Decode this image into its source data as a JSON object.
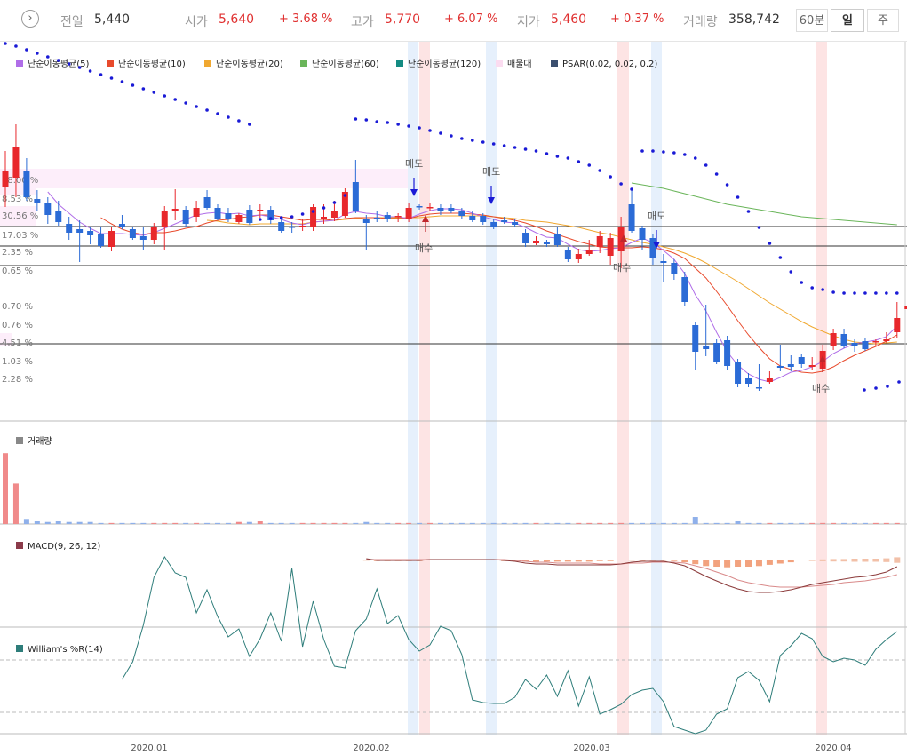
{
  "header": {
    "prev_label": "전일",
    "prev_value": "5,440",
    "open_label": "시가",
    "open_value": "5,640",
    "open_pct": "+ 3.68 %",
    "high_label": "고가",
    "high_value": "5,770",
    "high_pct": "+ 6.07 %",
    "low_label": "저가",
    "low_value": "5,460",
    "low_pct": "+ 0.37 %",
    "volume_label": "거래량",
    "volume_value": "358,742",
    "periods": [
      "60분",
      "일",
      "주"
    ],
    "active_period": "일"
  },
  "legend": [
    {
      "label": "단순이동평균(5)",
      "color": "#b06ee8"
    },
    {
      "label": "단순이동평균(10)",
      "color": "#e84a2c"
    },
    {
      "label": "단순이동평균(20)",
      "color": "#f0a830"
    },
    {
      "label": "단순이동평균(60)",
      "color": "#6ab55a"
    },
    {
      "label": "단순이동평균(120)",
      "color": "#138b82"
    },
    {
      "label": "매물대",
      "color": "#fbdcf0"
    },
    {
      "label": "PSAR(0.02, 0.02, 0.2)",
      "color": "#3a4e6e"
    }
  ],
  "colors": {
    "up": "#e8282c",
    "down": "#2b6bd6",
    "psar": "#1a1ad6",
    "macd": "#8b3a3a",
    "signal": "#d98a8a",
    "williams": "#2e7d7a"
  },
  "chart_data": {
    "type": "candlestick",
    "price_axis_labels": [
      "48.00 %",
      "8.53 %",
      "30.56 %",
      "17.03 %",
      "2.35 %",
      "0.65 %",
      "0.70 %",
      "0.76 %",
      "4.51 %",
      "1.03 %",
      "2.28 %"
    ],
    "x_tick_labels": [
      "2020.01",
      "2020.02",
      "2020.03",
      "2020.04"
    ],
    "signal_labels": [
      "매도",
      "매수",
      "매도",
      "매수",
      "매도",
      "매수"
    ],
    "volume_panel_title": "거래량",
    "macd_panel_title": "MACD(9, 26, 12)",
    "williams_panel_title": "William's %R(14)",
    "candles": [
      {
        "o": 210,
        "c": 193,
        "h": 170,
        "l": 233
      },
      {
        "o": 200,
        "c": 165,
        "h": 140,
        "l": 222
      },
      {
        "o": 192,
        "c": 222,
        "h": 178,
        "l": 226
      },
      {
        "o": 224,
        "c": 228,
        "h": 214,
        "l": 238
      },
      {
        "o": 228,
        "c": 242,
        "h": 222,
        "l": 252
      },
      {
        "o": 238,
        "c": 250,
        "h": 226,
        "l": 254
      },
      {
        "o": 252,
        "c": 262,
        "h": 244,
        "l": 270
      },
      {
        "o": 258,
        "c": 262,
        "h": 248,
        "l": 295
      },
      {
        "o": 260,
        "c": 265,
        "h": 255,
        "l": 275
      },
      {
        "o": 263,
        "c": 277,
        "h": 256,
        "l": 279
      },
      {
        "o": 278,
        "c": 260,
        "h": 256,
        "l": 283
      },
      {
        "o": 252,
        "c": 255,
        "h": 242,
        "l": 258
      },
      {
        "o": 258,
        "c": 268,
        "h": 255,
        "l": 270
      },
      {
        "o": 266,
        "c": 270,
        "h": 255,
        "l": 282
      },
      {
        "o": 270,
        "c": 255,
        "h": 251,
        "l": 275
      },
      {
        "o": 255,
        "c": 238,
        "h": 232,
        "l": 282
      },
      {
        "o": 238,
        "c": 235,
        "h": 213,
        "l": 248
      },
      {
        "o": 236,
        "c": 252,
        "h": 232,
        "l": 255
      },
      {
        "o": 244,
        "c": 234,
        "h": 226,
        "l": 250
      },
      {
        "o": 222,
        "c": 234,
        "h": 214,
        "l": 236
      },
      {
        "o": 234,
        "c": 246,
        "h": 230,
        "l": 248
      },
      {
        "o": 240,
        "c": 247,
        "h": 234,
        "l": 250
      },
      {
        "o": 250,
        "c": 242,
        "h": 240,
        "l": 252
      },
      {
        "o": 236,
        "c": 251,
        "h": 231,
        "l": 253
      },
      {
        "o": 238,
        "c": 236,
        "h": 230,
        "l": 245
      },
      {
        "o": 236,
        "c": 248,
        "h": 232,
        "l": 252
      },
      {
        "o": 250,
        "c": 260,
        "h": 246,
        "l": 262
      },
      {
        "o": 255,
        "c": 255,
        "h": 250,
        "l": 262
      },
      {
        "o": 256,
        "c": 254,
        "h": 246,
        "l": 260
      },
      {
        "o": 256,
        "c": 233,
        "h": 230,
        "l": 260
      },
      {
        "o": 247,
        "c": 244,
        "h": 230,
        "l": 252
      },
      {
        "o": 245,
        "c": 237,
        "h": 226,
        "l": 249
      },
      {
        "o": 243,
        "c": 216,
        "h": 212,
        "l": 245
      },
      {
        "o": 205,
        "c": 237,
        "h": 180,
        "l": 240
      },
      {
        "o": 246,
        "c": 251,
        "h": 242,
        "l": 282
      },
      {
        "o": 245,
        "c": 245,
        "h": 238,
        "l": 250
      },
      {
        "o": 242,
        "c": 247,
        "h": 239,
        "l": 250
      },
      {
        "o": 244,
        "c": 243,
        "h": 240,
        "l": 250
      },
      {
        "o": 246,
        "c": 234,
        "h": 228,
        "l": 250
      },
      {
        "o": 232,
        "c": 233,
        "h": 230,
        "l": 236
      },
      {
        "o": 234,
        "c": 233,
        "h": 228,
        "l": 238
      },
      {
        "o": 234,
        "c": 238,
        "h": 230,
        "l": 242
      },
      {
        "o": 234,
        "c": 238,
        "h": 230,
        "l": 240
      },
      {
        "o": 238,
        "c": 243,
        "h": 234,
        "l": 246
      },
      {
        "o": 243,
        "c": 248,
        "h": 238,
        "l": 250
      },
      {
        "o": 243,
        "c": 250,
        "h": 240,
        "l": 253
      },
      {
        "o": 250,
        "c": 256,
        "h": 246,
        "l": 258
      },
      {
        "o": 248,
        "c": 250,
        "h": 244,
        "l": 252
      },
      {
        "o": 250,
        "c": 253,
        "h": 246,
        "l": 255
      },
      {
        "o": 262,
        "c": 274,
        "h": 258,
        "l": 278
      },
      {
        "o": 274,
        "c": 271,
        "h": 266,
        "l": 276
      },
      {
        "o": 272,
        "c": 275,
        "h": 270,
        "l": 278
      },
      {
        "o": 264,
        "c": 276,
        "h": 255,
        "l": 278
      },
      {
        "o": 282,
        "c": 292,
        "h": 278,
        "l": 295
      },
      {
        "o": 292,
        "c": 286,
        "h": 280,
        "l": 296
      },
      {
        "o": 286,
        "c": 282,
        "h": 270,
        "l": 288
      },
      {
        "o": 278,
        "c": 266,
        "h": 260,
        "l": 285
      },
      {
        "o": 288,
        "c": 268,
        "h": 262,
        "l": 298
      },
      {
        "o": 283,
        "c": 256,
        "h": 244,
        "l": 302
      },
      {
        "o": 230,
        "c": 260,
        "h": 214,
        "l": 262
      },
      {
        "o": 257,
        "c": 270,
        "h": 254,
        "l": 282
      },
      {
        "o": 268,
        "c": 290,
        "h": 264,
        "l": 298
      },
      {
        "o": 294,
        "c": 296,
        "h": 286,
        "l": 318
      },
      {
        "o": 296,
        "c": 308,
        "h": 292,
        "l": 315
      },
      {
        "o": 312,
        "c": 340,
        "h": 306,
        "l": 345
      },
      {
        "o": 366,
        "c": 396,
        "h": 362,
        "l": 416
      },
      {
        "o": 390,
        "c": 393,
        "h": 343,
        "l": 401
      },
      {
        "o": 386,
        "c": 407,
        "h": 382,
        "l": 410
      },
      {
        "o": 383,
        "c": 412,
        "h": 378,
        "l": 416
      },
      {
        "o": 408,
        "c": 432,
        "h": 404,
        "l": 436
      },
      {
        "o": 426,
        "c": 432,
        "h": 420,
        "l": 436
      },
      {
        "o": 436,
        "c": 436,
        "h": 410,
        "l": 440
      },
      {
        "o": 430,
        "c": 426,
        "h": 418,
        "l": 432
      },
      {
        "o": 412,
        "c": 414,
        "h": 388,
        "l": 418
      },
      {
        "o": 410,
        "c": 413,
        "h": 400,
        "l": 418
      },
      {
        "o": 402,
        "c": 410,
        "h": 398,
        "l": 414
      },
      {
        "o": 413,
        "c": 411,
        "h": 402,
        "l": 416
      },
      {
        "o": 415,
        "c": 395,
        "h": 388,
        "l": 416
      },
      {
        "o": 390,
        "c": 375,
        "h": 370,
        "l": 394
      },
      {
        "o": 376,
        "c": 389,
        "h": 370,
        "l": 392
      },
      {
        "o": 386,
        "c": 390,
        "h": 382,
        "l": 396
      },
      {
        "o": 384,
        "c": 393,
        "h": 380,
        "l": 395
      },
      {
        "o": 385,
        "c": 384,
        "h": 382,
        "l": 390
      },
      {
        "o": 384,
        "c": 382,
        "h": 374,
        "l": 386
      },
      {
        "o": 374,
        "c": 358,
        "h": 340,
        "l": 380
      },
      {
        "o": 348,
        "c": 344,
        "h": 340,
        "l": 358
      }
    ],
    "ma5": [
      null,
      null,
      null,
      null,
      216,
      230,
      240,
      250,
      257,
      263,
      263,
      263,
      264,
      265,
      262,
      257,
      252,
      247,
      242,
      240,
      239,
      241,
      240,
      243,
      242,
      244,
      247,
      251,
      253,
      250,
      249,
      248,
      241,
      238,
      240,
      241,
      244,
      244,
      246,
      241,
      237,
      235,
      235,
      236,
      240,
      244,
      247,
      250,
      251,
      256,
      262,
      267,
      268,
      275,
      281,
      283,
      282,
      280,
      279,
      273,
      268,
      273,
      282,
      292,
      308,
      332,
      350,
      374,
      396,
      411,
      421,
      427,
      430,
      425,
      419,
      417,
      413,
      407,
      398,
      392,
      387,
      385,
      383,
      379,
      367
    ],
    "ma10": [
      null,
      null,
      null,
      null,
      null,
      null,
      null,
      null,
      null,
      245,
      252,
      258,
      262,
      264,
      262,
      262,
      260,
      257,
      255,
      251,
      248,
      247,
      245,
      244,
      242,
      242,
      244,
      246,
      248,
      247,
      247,
      248,
      246,
      245,
      245,
      245,
      246,
      246,
      246,
      243,
      241,
      240,
      240,
      240,
      241,
      242,
      244,
      246,
      248,
      251,
      255,
      260,
      264,
      268,
      272,
      275,
      278,
      279,
      279,
      279,
      278,
      279,
      281,
      285,
      291,
      302,
      313,
      328,
      344,
      361,
      377,
      391,
      404,
      412,
      416,
      419,
      420,
      418,
      413,
      406,
      400,
      395,
      390,
      384,
      377
    ],
    "ma20": [
      null,
      null,
      null,
      null,
      null,
      null,
      null,
      null,
      null,
      null,
      null,
      null,
      null,
      null,
      null,
      null,
      null,
      null,
      null,
      248,
      249,
      251,
      252,
      253,
      252,
      252,
      252,
      252,
      252,
      250,
      249,
      248,
      247,
      246,
      245,
      245,
      245,
      245,
      245,
      245,
      244,
      243,
      243,
      243,
      243,
      243,
      244,
      245,
      246,
      248,
      249,
      250,
      252,
      254,
      256,
      259,
      262,
      264,
      267,
      270,
      273,
      275,
      278,
      281,
      285,
      290,
      296,
      303,
      310,
      317,
      325,
      333,
      341,
      348,
      355,
      362,
      368,
      373,
      378,
      382,
      385,
      386,
      387,
      386,
      385
    ],
    "ma60": [
      null,
      null,
      null,
      null,
      null,
      null,
      null,
      null,
      null,
      null,
      null,
      null,
      null,
      null,
      null,
      null,
      null,
      null,
      null,
      null,
      null,
      null,
      null,
      null,
      null,
      null,
      null,
      null,
      null,
      null,
      null,
      null,
      null,
      null,
      null,
      null,
      null,
      null,
      null,
      null,
      null,
      null,
      null,
      null,
      null,
      null,
      null,
      null,
      null,
      null,
      null,
      null,
      null,
      null,
      null,
      null,
      null,
      null,
      null,
      206,
      208,
      210,
      212,
      215,
      218,
      221,
      224,
      227,
      230,
      232,
      234,
      236,
      238,
      240,
      242,
      244,
      245,
      246,
      247,
      248,
      249,
      250,
      251,
      252,
      253
    ],
    "psar": [
      49,
      52,
      56,
      60,
      64,
      68,
      72,
      76,
      80,
      84,
      88,
      92,
      96,
      100,
      104,
      108,
      112,
      116,
      120,
      124,
      128,
      132,
      136,
      140,
      247,
      246,
      245,
      244,
      241,
      238,
      234,
      228,
      220,
      134,
      135,
      137,
      138,
      140,
      142,
      144,
      147,
      150,
      153,
      156,
      158,
      160,
      162,
      164,
      166,
      168,
      170,
      173,
      176,
      178,
      182,
      186,
      192,
      199,
      207,
      213,
      170,
      170,
      171,
      172,
      174,
      178,
      186,
      196,
      208,
      222,
      238,
      256,
      274,
      290,
      306,
      318,
      324,
      326,
      329,
      330,
      330,
      330,
      330,
      330,
      330
    ],
    "volume": [
      140,
      80,
      10,
      6,
      4,
      6,
      4,
      4,
      4,
      2,
      2,
      2,
      2,
      2,
      2,
      2,
      2,
      2,
      2,
      2,
      2,
      2,
      4,
      4,
      6,
      2,
      2,
      2,
      2,
      2,
      2,
      2,
      2,
      2,
      4,
      2,
      2,
      2,
      2,
      2,
      2,
      2,
      2,
      2,
      2,
      2,
      2,
      2,
      2,
      2,
      2,
      2,
      2,
      2,
      2,
      2,
      2,
      2,
      2,
      2,
      2,
      2,
      2,
      2,
      2,
      14,
      2,
      2,
      2,
      6,
      2,
      2,
      2,
      2,
      2,
      2,
      2,
      2,
      2,
      2,
      2,
      2,
      2,
      2,
      2
    ],
    "macd": [
      null,
      null,
      null,
      null,
      null,
      null,
      null,
      null,
      null,
      null,
      null,
      null,
      null,
      null,
      null,
      null,
      null,
      null,
      null,
      null,
      null,
      null,
      null,
      null,
      null,
      null,
      null,
      null,
      null,
      null,
      null,
      null,
      null,
      null,
      583,
      585,
      585,
      585,
      585,
      585,
      584,
      584,
      584,
      584,
      584,
      584,
      584,
      585,
      586,
      588,
      589,
      589,
      590,
      590,
      590,
      590,
      590,
      590,
      589,
      587,
      586,
      586,
      586,
      588,
      591,
      597,
      603,
      608,
      613,
      617,
      620,
      621,
      621,
      620,
      618,
      615,
      612,
      610,
      608,
      606,
      604,
      603,
      601,
      598,
      592
    ],
    "signal": [
      null,
      null,
      null,
      null,
      null,
      null,
      null,
      null,
      null,
      null,
      null,
      null,
      null,
      null,
      null,
      null,
      null,
      null,
      null,
      null,
      null,
      null,
      null,
      null,
      null,
      null,
      null,
      null,
      null,
      null,
      null,
      null,
      null,
      null,
      584,
      584,
      584,
      584,
      584,
      584,
      584,
      584,
      584,
      584,
      584,
      584,
      584,
      584,
      585,
      586,
      587,
      587,
      588,
      588,
      588,
      588,
      589,
      589,
      589,
      588,
      588,
      587,
      587,
      587,
      588,
      591,
      594,
      598,
      602,
      607,
      610,
      612,
      614,
      615,
      615,
      615,
      614,
      613,
      612,
      610,
      609,
      608,
      606,
      604,
      601
    ],
    "williams": [
      null,
      null,
      null,
      null,
      null,
      null,
      null,
      null,
      null,
      null,
      null,
      765,
      745,
      704,
      650,
      627,
      645,
      650,
      690,
      664,
      694,
      717,
      708,
      739,
      719,
      690,
      722,
      640,
      728,
      677,
      720,
      750,
      752,
      710,
      697,
      663,
      702,
      693,
      720,
      733,
      726,
      705,
      710,
      737,
      788,
      791,
      792,
      792,
      785,
      765,
      776,
      760,
      784,
      755,
      795,
      762,
      804,
      799,
      793,
      782,
      777,
      775,
      790,
      818,
      822,
      826,
      822,
      804,
      798,
      763,
      756,
      766,
      790,
      738,
      727,
      713,
      719,
      739,
      745,
      741,
      743,
      749,
      731,
      720,
      711
    ]
  }
}
